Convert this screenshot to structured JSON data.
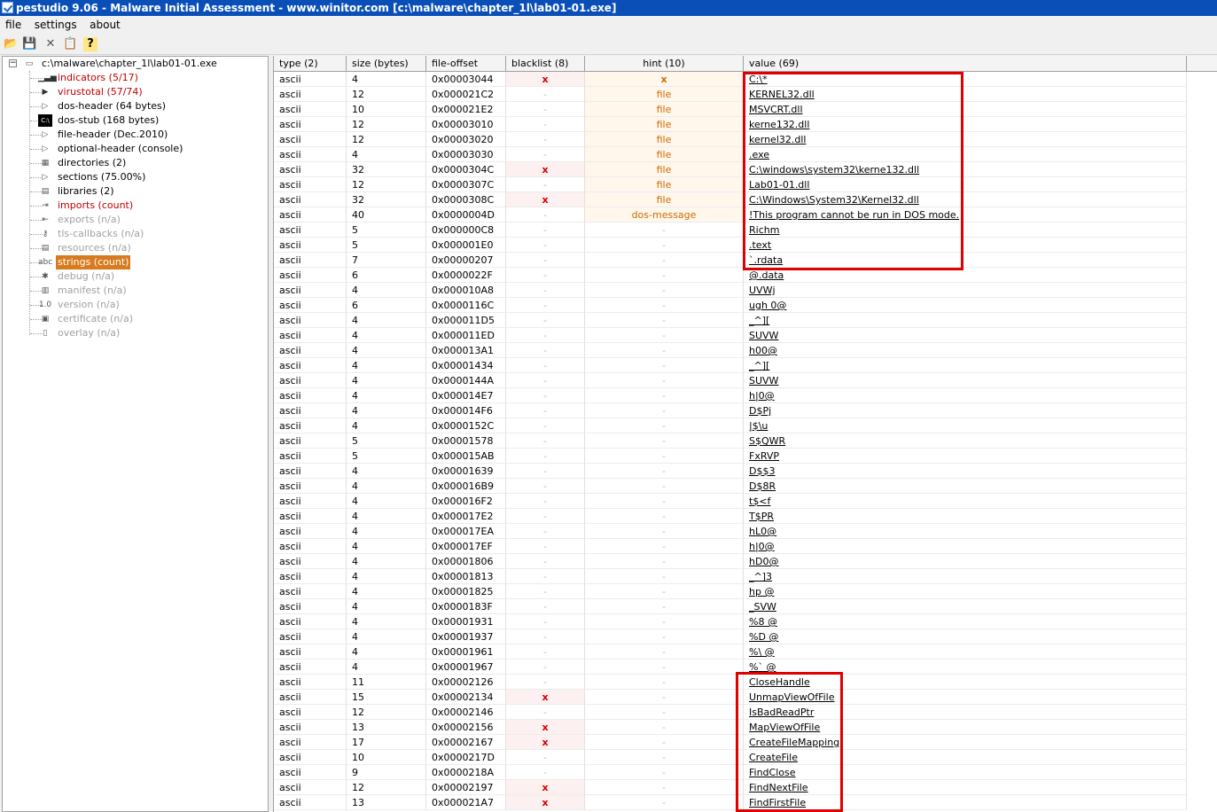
{
  "window": {
    "title": "pestudio 9.06 - Malware Initial Assessment - www.winitor.com [c:\\malware\\chapter_1l\\lab01-01.exe]"
  },
  "menu": [
    "file",
    "settings",
    "about"
  ],
  "toolbar": [
    {
      "icon": "folder-open-icon",
      "glyph": "📂"
    },
    {
      "icon": "save-icon",
      "glyph": "💾"
    },
    {
      "icon": "close-icon",
      "glyph": "✕"
    },
    {
      "icon": "clipboard-icon",
      "glyph": "📋"
    },
    {
      "icon": "help-icon",
      "glyph": "?"
    }
  ],
  "tree": {
    "root": "c:\\malware\\chapter_1l\\lab01-01.exe",
    "items": [
      {
        "label": "indicators (5/17)",
        "style": "red",
        "icon": "bar-chart-icon",
        "glyph": "▁▃▅"
      },
      {
        "label": "virustotal (57/74)",
        "style": "red",
        "icon": "virustotal-icon",
        "glyph": "▶"
      },
      {
        "label": "dos-header (64 bytes)",
        "style": "",
        "icon": "chevron-right-icon",
        "glyph": "▷"
      },
      {
        "label": "dos-stub (168 bytes)",
        "style": "",
        "icon": "console-icon",
        "glyph": "C:\\"
      },
      {
        "label": "file-header (Dec.2010)",
        "style": "",
        "icon": "chevron-right-icon",
        "glyph": "▷"
      },
      {
        "label": "optional-header (console)",
        "style": "",
        "icon": "chevron-right-icon",
        "glyph": "▷"
      },
      {
        "label": "directories (2)",
        "style": "",
        "icon": "directories-icon",
        "glyph": "▦"
      },
      {
        "label": "sections (75.00%)",
        "style": "",
        "icon": "chevron-right-icon",
        "glyph": "▷"
      },
      {
        "label": "libraries (2)",
        "style": "",
        "icon": "library-icon",
        "glyph": "▤"
      },
      {
        "label": "imports (count)",
        "style": "red",
        "icon": "imports-icon",
        "glyph": "⇥"
      },
      {
        "label": "exports (n/a)",
        "style": "grey",
        "icon": "exports-icon",
        "glyph": "⇤"
      },
      {
        "label": "tls-callbacks (n/a)",
        "style": "grey",
        "icon": "key-icon",
        "glyph": "⚷"
      },
      {
        "label": "resources (n/a)",
        "style": "grey",
        "icon": "resources-icon",
        "glyph": "▤"
      },
      {
        "label": "strings (count)",
        "style": "sel",
        "icon": "strings-icon",
        "glyph": "abc"
      },
      {
        "label": "debug (n/a)",
        "style": "grey",
        "icon": "bug-icon",
        "glyph": "✱"
      },
      {
        "label": "manifest (n/a)",
        "style": "grey",
        "icon": "manifest-icon",
        "glyph": "▥"
      },
      {
        "label": "version (n/a)",
        "style": "grey",
        "icon": "version-icon",
        "glyph": "1.0"
      },
      {
        "label": "certificate (n/a)",
        "style": "grey",
        "icon": "certificate-icon",
        "glyph": "▣"
      },
      {
        "label": "overlay (n/a)",
        "style": "grey",
        "icon": "file-icon",
        "glyph": "▯"
      }
    ]
  },
  "table": {
    "headers": [
      "type (2)",
      "size (bytes)",
      "file-offset",
      "blacklist (8)",
      "hint (10)",
      "value (69)"
    ],
    "rows": [
      [
        "ascii",
        "4",
        "0x00003044",
        "x",
        "x",
        "C:\\*"
      ],
      [
        "ascii",
        "12",
        "0x000021C2",
        "-",
        "file",
        "KERNEL32.dll"
      ],
      [
        "ascii",
        "10",
        "0x000021E2",
        "-",
        "file",
        "MSVCRT.dll"
      ],
      [
        "ascii",
        "12",
        "0x00003010",
        "-",
        "file",
        "kerne132.dll"
      ],
      [
        "ascii",
        "12",
        "0x00003020",
        "-",
        "file",
        "kernel32.dll"
      ],
      [
        "ascii",
        "4",
        "0x00003030",
        "-",
        "file",
        ".exe"
      ],
      [
        "ascii",
        "32",
        "0x0000304C",
        "x",
        "file",
        "C:\\windows\\system32\\kerne132.dll"
      ],
      [
        "ascii",
        "12",
        "0x0000307C",
        "-",
        "file",
        "Lab01-01.dll"
      ],
      [
        "ascii",
        "32",
        "0x0000308C",
        "x",
        "file",
        "C:\\Windows\\System32\\Kernel32.dll"
      ],
      [
        "ascii",
        "40",
        "0x0000004D",
        "-",
        "dos-message",
        "!This program cannot be run in DOS mode."
      ],
      [
        "ascii",
        "5",
        "0x000000C8",
        "-",
        "-",
        "Richm"
      ],
      [
        "ascii",
        "5",
        "0x000001E0",
        "-",
        "-",
        ".text"
      ],
      [
        "ascii",
        "7",
        "0x00000207",
        "-",
        "-",
        "`.rdata"
      ],
      [
        "ascii",
        "6",
        "0x0000022F",
        "-",
        "-",
        "@.data"
      ],
      [
        "ascii",
        "4",
        "0x000010A8",
        "-",
        "-",
        "UVWj"
      ],
      [
        "ascii",
        "6",
        "0x0000116C",
        "-",
        "-",
        "ugh 0@"
      ],
      [
        "ascii",
        "4",
        "0x000011D5",
        "-",
        "-",
        "_^]["
      ],
      [
        "ascii",
        "4",
        "0x000011ED",
        "-",
        "-",
        "SUVW"
      ],
      [
        "ascii",
        "4",
        "0x000013A1",
        "-",
        "-",
        "h00@"
      ],
      [
        "ascii",
        "4",
        "0x00001434",
        "-",
        "-",
        "_^]["
      ],
      [
        "ascii",
        "4",
        "0x0000144A",
        "-",
        "-",
        "SUVW"
      ],
      [
        "ascii",
        "4",
        "0x000014E7",
        "-",
        "-",
        "h|0@"
      ],
      [
        "ascii",
        "4",
        "0x000014F6",
        "-",
        "-",
        "D$Pj"
      ],
      [
        "ascii",
        "4",
        "0x0000152C",
        "-",
        "-",
        "|$\\u"
      ],
      [
        "ascii",
        "5",
        "0x00001578",
        "-",
        "-",
        "S$QWR"
      ],
      [
        "ascii",
        "5",
        "0x000015AB",
        "-",
        "-",
        "FxRVP"
      ],
      [
        "ascii",
        "4",
        "0x00001639",
        "-",
        "-",
        "D$$3"
      ],
      [
        "ascii",
        "4",
        "0x000016B9",
        "-",
        "-",
        "D$8R"
      ],
      [
        "ascii",
        "4",
        "0x000016F2",
        "-",
        "-",
        "t$<f"
      ],
      [
        "ascii",
        "4",
        "0x000017E2",
        "-",
        "-",
        "T$PR"
      ],
      [
        "ascii",
        "4",
        "0x000017EA",
        "-",
        "-",
        "hL0@"
      ],
      [
        "ascii",
        "4",
        "0x000017EF",
        "-",
        "-",
        "h|0@"
      ],
      [
        "ascii",
        "4",
        "0x00001806",
        "-",
        "-",
        "hD0@"
      ],
      [
        "ascii",
        "4",
        "0x00001813",
        "-",
        "-",
        "_^]3"
      ],
      [
        "ascii",
        "4",
        "0x00001825",
        "-",
        "-",
        "hp @"
      ],
      [
        "ascii",
        "4",
        "0x0000183F",
        "-",
        "-",
        "_SVW"
      ],
      [
        "ascii",
        "4",
        "0x00001931",
        "-",
        "-",
        "%8 @"
      ],
      [
        "ascii",
        "4",
        "0x00001937",
        "-",
        "-",
        "%D @"
      ],
      [
        "ascii",
        "4",
        "0x00001961",
        "-",
        "-",
        "%\\ @"
      ],
      [
        "ascii",
        "4",
        "0x00001967",
        "-",
        "-",
        "%` @"
      ],
      [
        "ascii",
        "11",
        "0x00002126",
        "-",
        "-",
        "CloseHandle"
      ],
      [
        "ascii",
        "15",
        "0x00002134",
        "x",
        "-",
        "UnmapViewOfFile"
      ],
      [
        "ascii",
        "12",
        "0x00002146",
        "-",
        "-",
        "IsBadReadPtr"
      ],
      [
        "ascii",
        "13",
        "0x00002156",
        "x",
        "-",
        "MapViewOfFile"
      ],
      [
        "ascii",
        "17",
        "0x00002167",
        "x",
        "-",
        "CreateFileMapping"
      ],
      [
        "ascii",
        "10",
        "0x0000217D",
        "-",
        "-",
        "CreateFile"
      ],
      [
        "ascii",
        "9",
        "0x0000218A",
        "-",
        "-",
        "FindClose"
      ],
      [
        "ascii",
        "12",
        "0x00002197",
        "x",
        "-",
        "FindNextFile"
      ],
      [
        "ascii",
        "13",
        "0x000021A7",
        "x",
        "-",
        "FindFirstFile"
      ]
    ]
  }
}
